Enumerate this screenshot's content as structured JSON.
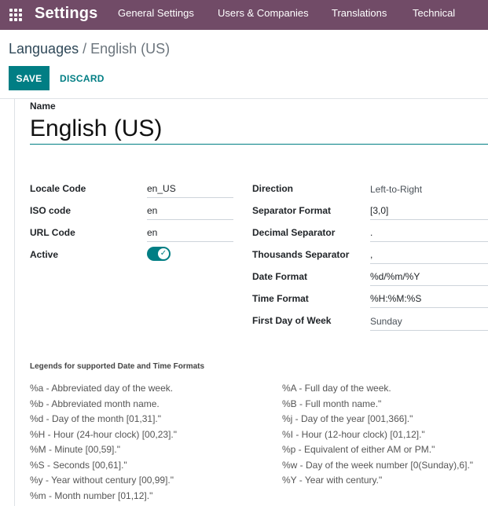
{
  "topbar": {
    "apps_icon": "apps-grid-icon",
    "app_title": "Settings",
    "menu": [
      "General Settings",
      "Users & Companies",
      "Translations",
      "Technical"
    ]
  },
  "breadcrumb": {
    "parent": "Languages",
    "separator": "/",
    "current": "English (US)"
  },
  "actions": {
    "save": "SAVE",
    "discard": "DISCARD"
  },
  "form": {
    "name_label": "Name",
    "name_value": "English (US)",
    "left_fields": [
      {
        "label": "Locale Code",
        "value": "en_US"
      },
      {
        "label": "ISO code",
        "value": "en"
      },
      {
        "label": "URL Code",
        "value": "en"
      },
      {
        "label": "Active",
        "value": ""
      }
    ],
    "active": true,
    "right_fields": [
      {
        "label": "Direction",
        "value": "Left-to-Right"
      },
      {
        "label": "Separator Format",
        "value": "[3,0]"
      },
      {
        "label": "Decimal Separator",
        "value": "."
      },
      {
        "label": "Thousands Separator",
        "value": ","
      },
      {
        "label": "Date Format",
        "value": "%d/%m/%Y"
      },
      {
        "label": "Time Format",
        "value": "%H:%M:%S"
      },
      {
        "label": "First Day of Week",
        "value": "Sunday"
      }
    ]
  },
  "legends": {
    "title": "Legends for supported Date and Time Formats",
    "left": [
      "%a - Abbreviated day of the week.",
      "%b - Abbreviated month name.",
      "%d - Day of the month [01,31].\"",
      "%H - Hour (24-hour clock) [00,23].\"",
      "%M - Minute [00,59].\"",
      "%S - Seconds [00,61].\"",
      "%y - Year without century [00,99].\"",
      "%m - Month number [01,12].\""
    ],
    "right": [
      "%A - Full day of the week.",
      "%B - Full month name.\"",
      "%j - Day of the year [001,366].\"",
      "%I - Hour (12-hour clock) [01,12].\"",
      "%p - Equivalent of either AM or PM.\"",
      "%w - Day of the week number [0(Sunday),6].\"",
      "%Y - Year with century.\""
    ]
  }
}
